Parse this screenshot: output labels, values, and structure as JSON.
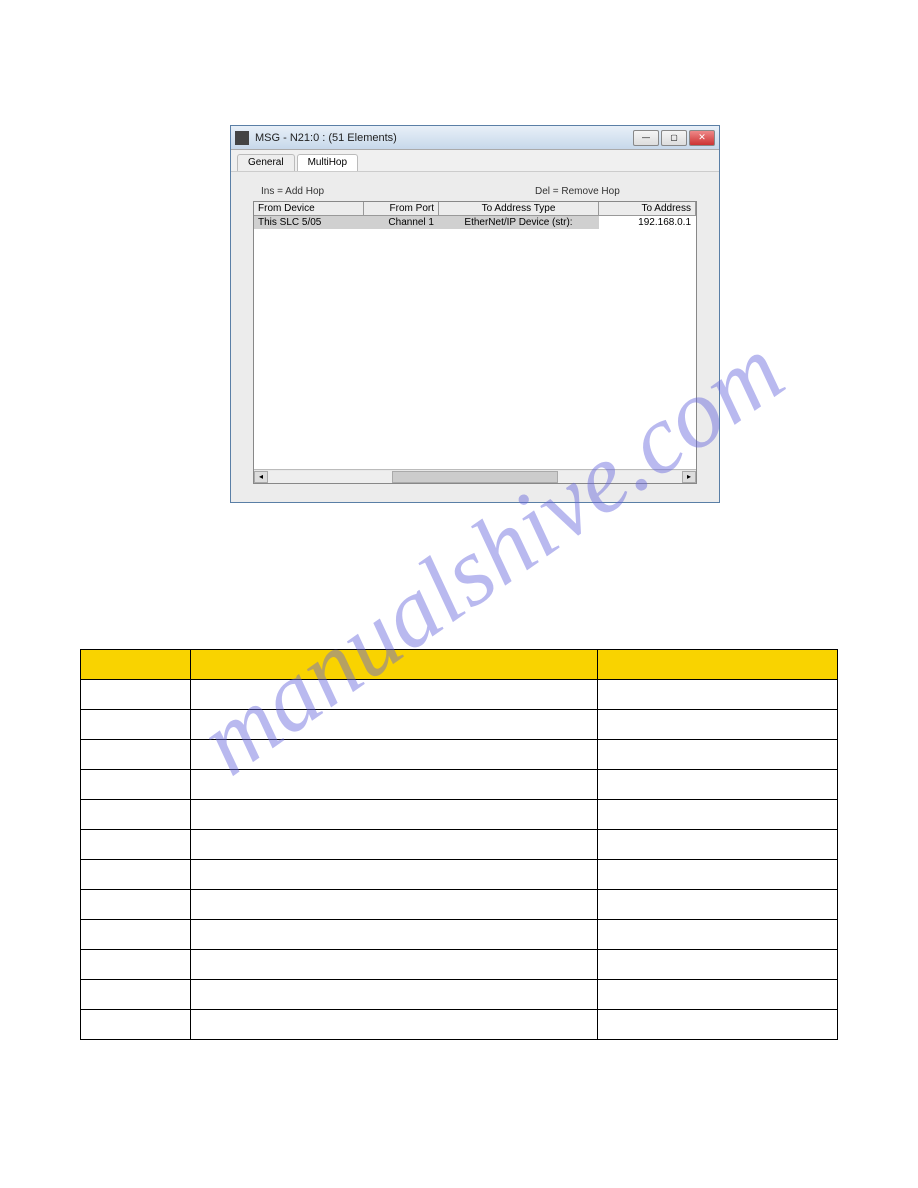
{
  "dialog": {
    "title": "MSG - N21:0 : (51 Elements)",
    "tabs": {
      "general": "General",
      "multihop": "MultiHop"
    },
    "hints": {
      "add": "Ins = Add Hop",
      "remove": "Del = Remove Hop"
    },
    "columns": {
      "from_device": "From Device",
      "from_port": "From Port",
      "to_addr_type": "To Address Type",
      "to_addr": "To Address"
    },
    "rows": [
      {
        "from_device": "This SLC 5/05",
        "from_port": "Channel 1",
        "to_addr_type": "EtherNet/IP Device (str):",
        "to_addr": "192.168.0.1"
      }
    ]
  },
  "table": {
    "headers": {
      "a": "",
      "b": "",
      "c": ""
    },
    "rows": [
      {
        "a": "",
        "b": "",
        "c": ""
      },
      {
        "a": "",
        "b": "",
        "c": ""
      },
      {
        "a": "",
        "b": "",
        "c": ""
      },
      {
        "a": "",
        "b": "",
        "c": ""
      },
      {
        "a": "",
        "b": "",
        "c": ""
      },
      {
        "a": "",
        "b": "",
        "c": ""
      },
      {
        "a": "",
        "b": "",
        "c": ""
      },
      {
        "a": "",
        "b": "",
        "c": ""
      },
      {
        "a": "",
        "b": "",
        "c": ""
      },
      {
        "a": "",
        "b": "",
        "c": ""
      },
      {
        "a": "",
        "b": "",
        "c": ""
      },
      {
        "a": "",
        "b": "",
        "c": ""
      }
    ]
  },
  "watermark": "manualshive.com"
}
